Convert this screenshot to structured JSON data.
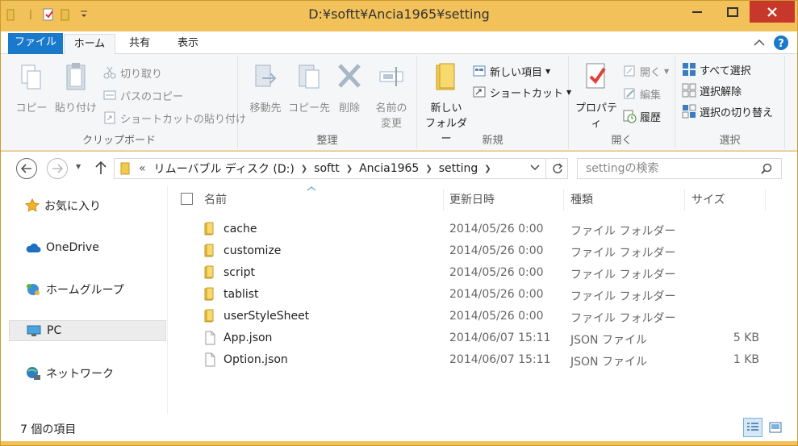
{
  "window": {
    "title": "D:¥softt¥Ancia1965¥setting"
  },
  "tabs": {
    "file": "ファイル",
    "home": "ホーム",
    "share": "共有",
    "view": "表示"
  },
  "ribbon": {
    "clipboard": {
      "copy": "コピー",
      "paste": "貼り付け",
      "cut": "切り取り",
      "copy_path": "パスのコピー",
      "paste_shortcut": "ショートカットの貼り付け",
      "label": "クリップボード"
    },
    "organize": {
      "move_to": "移動先",
      "copy_to": "コピー先",
      "delete": "削除",
      "rename_line1": "名前の",
      "rename_line2": "変更",
      "label": "整理"
    },
    "new": {
      "new_folder_line1": "新しい",
      "new_folder_line2": "フォルダー",
      "new_item": "新しい項目",
      "shortcut": "ショートカット",
      "label": "新規"
    },
    "open": {
      "properties": "プロパティ",
      "open": "開く",
      "edit": "編集",
      "history": "履歴",
      "label": "開く"
    },
    "select": {
      "select_all": "すべて選択",
      "select_none": "選択解除",
      "invert": "選択の切り替え",
      "label": "選択"
    }
  },
  "address": {
    "prefix": "«",
    "crumbs": [
      "リムーバブル ディスク (D:)",
      "softt",
      "Ancia1965",
      "setting"
    ],
    "search_placeholder": "settingの検索"
  },
  "nav": {
    "items": [
      "お気に入り",
      "OneDrive",
      "ホームグループ",
      "PC",
      "ネットワーク"
    ]
  },
  "columns": {
    "name": "名前",
    "date": "更新日時",
    "type": "種類",
    "size": "サイズ"
  },
  "files": [
    {
      "name": "cache",
      "date": "2014/05/26 0:00",
      "type": "ファイル フォルダー",
      "size": "",
      "kind": "folder"
    },
    {
      "name": "customize",
      "date": "2014/05/26 0:00",
      "type": "ファイル フォルダー",
      "size": "",
      "kind": "folder"
    },
    {
      "name": "script",
      "date": "2014/05/26 0:00",
      "type": "ファイル フォルダー",
      "size": "",
      "kind": "folder"
    },
    {
      "name": "tablist",
      "date": "2014/05/26 0:00",
      "type": "ファイル フォルダー",
      "size": "",
      "kind": "folder"
    },
    {
      "name": "userStyleSheet",
      "date": "2014/05/26 0:00",
      "type": "ファイル フォルダー",
      "size": "",
      "kind": "folder"
    },
    {
      "name": "App.json",
      "date": "2014/06/07 15:11",
      "type": "JSON ファイル",
      "size": "5 KB",
      "kind": "file"
    },
    {
      "name": "Option.json",
      "date": "2014/06/07 15:11",
      "type": "JSON ファイル",
      "size": "1 KB",
      "kind": "file"
    }
  ],
  "status": {
    "count": "7 個の項目"
  },
  "colors": {
    "accent": "#1979ca",
    "frame": "#f2c15a",
    "close": "#c7382a"
  }
}
